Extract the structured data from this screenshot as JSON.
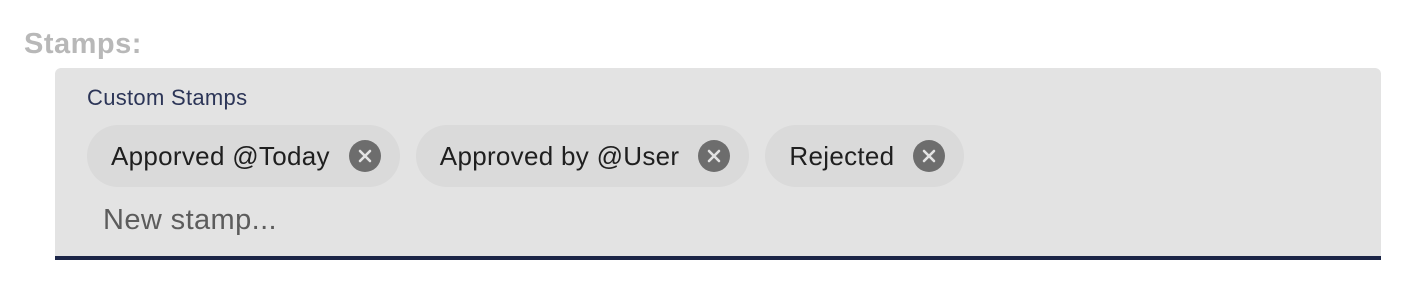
{
  "section": {
    "label": "Stamps:"
  },
  "stamps_field": {
    "label": "Custom Stamps",
    "chips": [
      {
        "label": "Apporved @Today",
        "remove_icon": "close-circle-icon"
      },
      {
        "label": "Approved by @User",
        "remove_icon": "close-circle-icon"
      },
      {
        "label": "Rejected",
        "remove_icon": "close-circle-icon"
      }
    ],
    "input": {
      "value": "",
      "placeholder": "New stamp..."
    }
  },
  "colors": {
    "field_background": "#e3e3e3",
    "chip_background": "#dadada",
    "remove_icon": "#6d6d6d",
    "underline_accent": "#1b2547",
    "section_label": "#b8b8b8"
  }
}
